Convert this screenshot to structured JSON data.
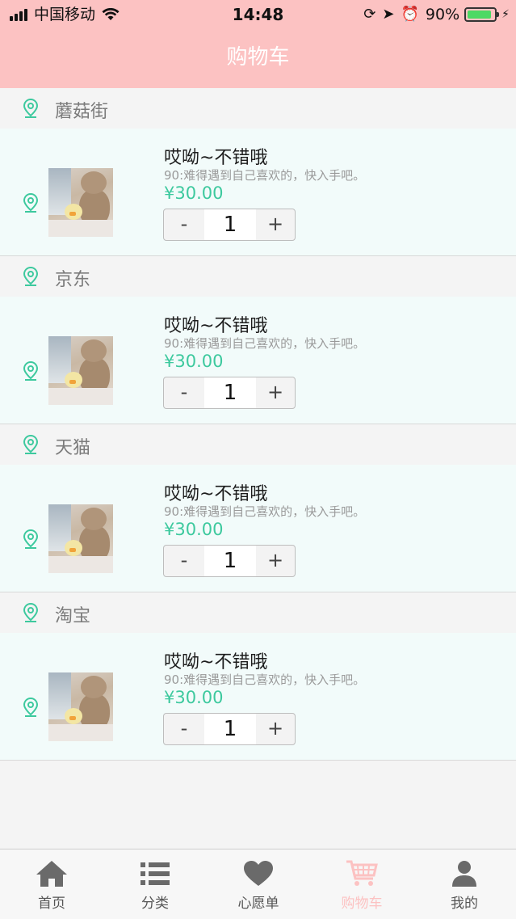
{
  "status_bar": {
    "carrier": "中国移动",
    "time": "14:48",
    "battery": "90%",
    "battery_level": 0.9
  },
  "header": {
    "title": "购物车"
  },
  "groups": [
    {
      "shop": "蘑菇街",
      "item": {
        "title": "哎呦~不错哦",
        "desc": "90:难得遇到自己喜欢的，快入手吧。",
        "price": "¥30.00",
        "qty": "1",
        "minus": "-",
        "plus": "+"
      }
    },
    {
      "shop": "京东",
      "item": {
        "title": "哎呦~不错哦",
        "desc": "90:难得遇到自己喜欢的，快入手吧。",
        "price": "¥30.00",
        "qty": "1",
        "minus": "-",
        "plus": "+"
      }
    },
    {
      "shop": "天猫",
      "item": {
        "title": "哎呦~不错哦",
        "desc": "90:难得遇到自己喜欢的，快入手吧。",
        "price": "¥30.00",
        "qty": "1",
        "minus": "-",
        "plus": "+"
      }
    },
    {
      "shop": "淘宝",
      "item": {
        "title": "哎呦~不错哦",
        "desc": "90:难得遇到自己喜欢的，快入手吧。",
        "price": "¥30.00",
        "qty": "1",
        "minus": "-",
        "plus": "+"
      }
    }
  ],
  "tabbar": {
    "items": [
      {
        "label": "首页",
        "icon": "home-icon"
      },
      {
        "label": "分类",
        "icon": "list-icon"
      },
      {
        "label": "心愿单",
        "icon": "heart-icon"
      },
      {
        "label": "购物车",
        "icon": "cart-icon"
      },
      {
        "label": "我的",
        "icon": "person-icon"
      }
    ],
    "active_index": 3
  },
  "colors": {
    "header_bg": "#fcc2c2",
    "accent": "#3dc99e",
    "item_bg": "#f2fbfa",
    "tab_active": "#fcc2c2"
  }
}
